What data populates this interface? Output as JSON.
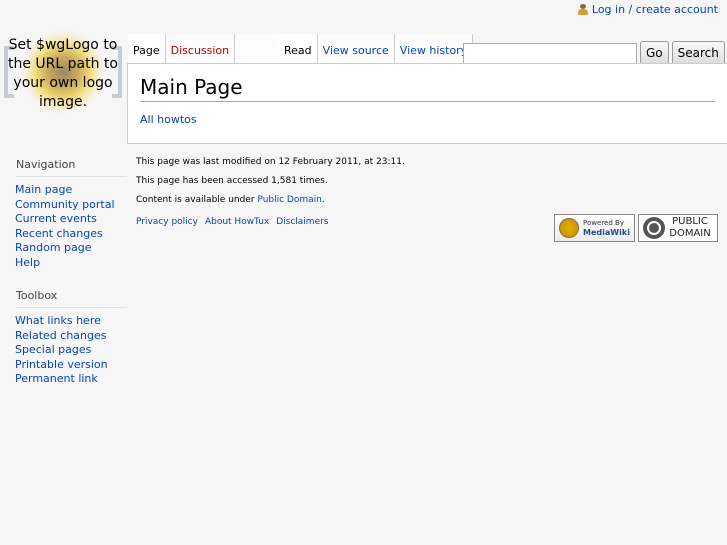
{
  "personal": {
    "login_label": "Log in / create account",
    "icon": "user-icon"
  },
  "logo": {
    "text": "Set $wgLogo to the URL path to your own logo image."
  },
  "tabs": {
    "left": [
      {
        "label": "Page",
        "state": "selected"
      },
      {
        "label": "Discussion",
        "state": "new"
      }
    ],
    "right": [
      {
        "label": "Read",
        "state": "selected"
      },
      {
        "label": "View source",
        "state": "normal"
      },
      {
        "label": "View history",
        "state": "normal"
      }
    ]
  },
  "search": {
    "value": "",
    "go_label": "Go",
    "search_label": "Search"
  },
  "content": {
    "title": "Main Page",
    "link": "All howtos"
  },
  "sidebar": {
    "navigation": {
      "heading": "Navigation",
      "items": [
        "Main page",
        "Community portal",
        "Current events",
        "Recent changes",
        "Random page",
        "Help"
      ]
    },
    "toolbox": {
      "heading": "Toolbox",
      "items": [
        "What links here",
        "Related changes",
        "Special pages",
        "Printable version",
        "Permanent link"
      ]
    }
  },
  "footer": {
    "lastmod": "This page was last modified on 12 February 2011, at 23:11.",
    "viewcount": "This page has been accessed 1,581 times.",
    "copyright_prefix": "Content is available under ",
    "copyright_link": "Public Domain",
    "copyright_suffix": ".",
    "links": [
      "Privacy policy",
      "About HowTux",
      "Disclaimers"
    ]
  },
  "badges": {
    "mediawiki": {
      "top": "Powered By",
      "bottom": "MediaWiki"
    },
    "public_domain": {
      "line1": "PUBLIC",
      "line2": "DOMAIN"
    }
  },
  "colors": {
    "link": "#0645ad",
    "new_link": "#ba0000",
    "content_border": "#a7d7f9",
    "background": "#f6f6f6"
  }
}
